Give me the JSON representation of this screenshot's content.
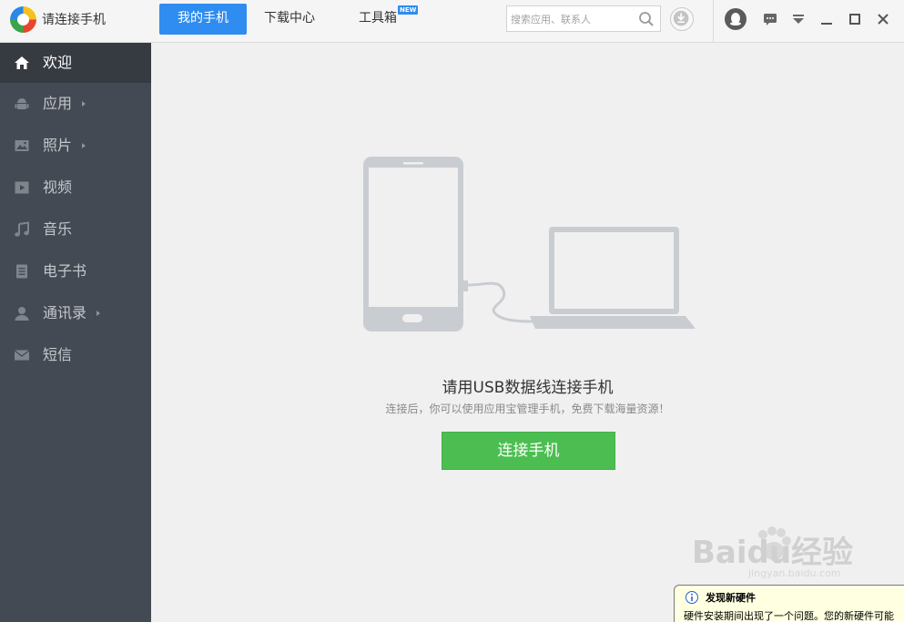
{
  "app": {
    "title": "请连接手机"
  },
  "tabs": [
    {
      "label": "我的手机",
      "active": true
    },
    {
      "label": "下载中心",
      "active": false
    },
    {
      "label": "工具箱",
      "active": false,
      "badge": "NEW"
    }
  ],
  "search": {
    "placeholder": "搜索应用、联系人"
  },
  "sidebar": {
    "items": [
      {
        "label": "欢迎",
        "icon": "home-icon",
        "active": true,
        "has_submenu": false
      },
      {
        "label": "应用",
        "icon": "android-icon",
        "active": false,
        "has_submenu": true
      },
      {
        "label": "照片",
        "icon": "image-icon",
        "active": false,
        "has_submenu": true
      },
      {
        "label": "视频",
        "icon": "video-icon",
        "active": false,
        "has_submenu": false
      },
      {
        "label": "音乐",
        "icon": "music-icon",
        "active": false,
        "has_submenu": false
      },
      {
        "label": "电子书",
        "icon": "book-icon",
        "active": false,
        "has_submenu": false
      },
      {
        "label": "通讯录",
        "icon": "contact-icon",
        "active": false,
        "has_submenu": true
      },
      {
        "label": "短信",
        "icon": "mail-icon",
        "active": false,
        "has_submenu": false
      }
    ]
  },
  "main": {
    "headline": "请用USB数据线连接手机",
    "subtext": "连接后，你可以使用应用宝管理手机，免费下载海量资源！",
    "connect_button": "连接手机"
  },
  "watermark": {
    "text": "Baidu经验",
    "url": "jingyan.baidu.com"
  },
  "notification": {
    "title": "发现新硬件",
    "text": "硬件安装期间出现了一个问题。您的新硬件可能"
  },
  "colors": {
    "accent_blue": "#2f8cf0",
    "sidebar_bg": "#444a53",
    "sidebar_active": "#363a41",
    "connect_green": "#4cbe51",
    "illustration_gray": "#c9cdd2"
  }
}
